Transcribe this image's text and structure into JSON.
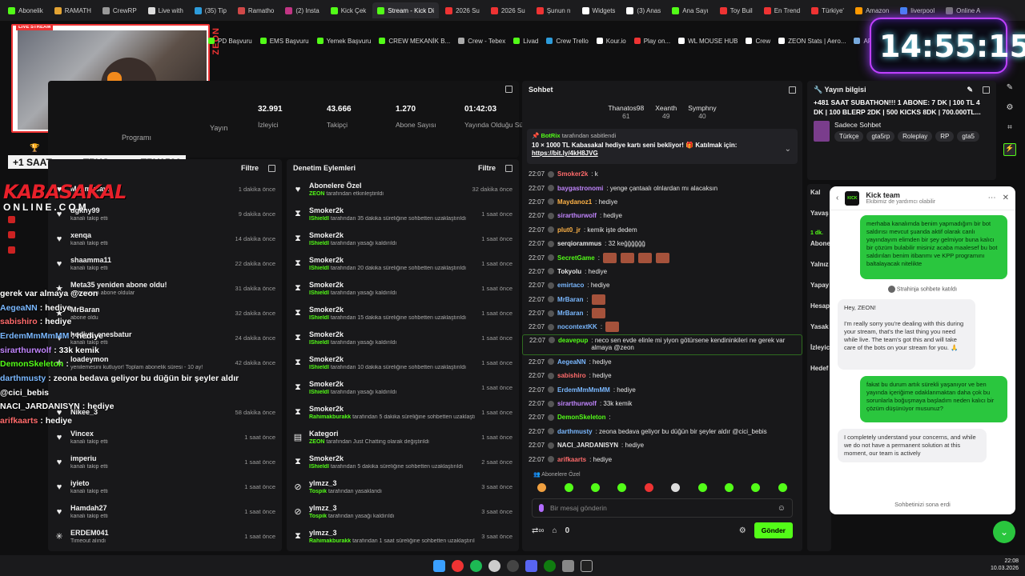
{
  "tabs": [
    {
      "label": "Abonelik",
      "color": "#53fc18"
    },
    {
      "label": "RAMATH",
      "color": "#e3a333"
    },
    {
      "label": "CrewRP",
      "color": "#999999"
    },
    {
      "label": "Live with",
      "color": "#dddddd"
    },
    {
      "label": "(35) Tip",
      "color": "#2d9cdb"
    },
    {
      "label": "Ramatho",
      "color": "#d04848"
    },
    {
      "label": "(2) Insta",
      "color": "#c13584"
    },
    {
      "label": "Kick Çek",
      "color": "#53fc18"
    },
    {
      "label": "Stream - Kick Di",
      "color": "#53fc18",
      "active": true
    },
    {
      "label": "2026 Su",
      "color": "#e33"
    },
    {
      "label": "2026 Su",
      "color": "#e33"
    },
    {
      "label": "Şunun n",
      "color": "#e33"
    },
    {
      "label": "Widgets",
      "color": "#fff"
    },
    {
      "label": "(3) Anas",
      "color": "#fff"
    },
    {
      "label": "Ana Sayı",
      "color": "#53fc18"
    },
    {
      "label": "Toy Buil",
      "color": "#e33"
    },
    {
      "label": "En Trend",
      "color": "#e33"
    },
    {
      "label": "Türkiye'",
      "color": "#e33"
    },
    {
      "label": "Amazon",
      "color": "#ff9900"
    },
    {
      "label": "liverpool",
      "color": "#4285f4"
    },
    {
      "label": "Online A",
      "color": "#777"
    }
  ],
  "bookmarks": [
    {
      "label": "PD Başvuru",
      "color": "#53fc18"
    },
    {
      "label": "EMS Başvuru",
      "color": "#53fc18"
    },
    {
      "label": "Yemek Başvuru",
      "color": "#53fc18"
    },
    {
      "label": "CREW MEKANİK B...",
      "color": "#53fc18"
    },
    {
      "label": "Crew - Tebex",
      "color": "#aaa"
    },
    {
      "label": "Livad",
      "color": "#53fc18"
    },
    {
      "label": "Crew Trello",
      "color": "#2d9cdb"
    },
    {
      "label": "Kour.io",
      "color": "#fff"
    },
    {
      "label": "Play on...",
      "color": "#e33"
    },
    {
      "label": "WL MOUSE HUB",
      "color": "#fff"
    },
    {
      "label": "Crew",
      "color": "#fff"
    },
    {
      "label": "ZEON Stats | Aero...",
      "color": "#fff"
    },
    {
      "label": "APIq",
      "color": "#7ad"
    }
  ],
  "clock": "14:55:15",
  "webcam": {
    "brand": "ZEON"
  },
  "subathon": {
    "left": "+1 SAAT",
    "mid": "TRYO",
    "right": "TRY1500"
  },
  "kabasakal": {
    "line1": "KABASAKAL",
    "line2": "ONLINE.COM"
  },
  "stats": [
    {
      "value": "32.991",
      "label": "İzleyici"
    },
    {
      "value": "43.666",
      "label": "Takipçi"
    },
    {
      "value": "1.270",
      "label": "Abone Sayısı"
    },
    {
      "value": "01:42:03",
      "label": "Yayında Olduğu Süre"
    }
  ],
  "stats_extra": {
    "yayin": "Yayın",
    "programi": "Programı"
  },
  "activity": {
    "filter": "Filtre",
    "rows": [
      {
        "t1": "Malimusavir",
        "t2": "",
        "time": "1 dakika önce",
        "icon": "♥"
      },
      {
        "t1": "dgkny99",
        "t2": "kanalı takip etti",
        "time": "9 dakika önce",
        "icon": "♥"
      },
      {
        "t1": "xenqa",
        "t2": "kanalı takip etti",
        "time": "14 dakika önce",
        "icon": "♥"
      },
      {
        "t1": "shaamma11",
        "t2": "kanalı takip etti",
        "time": "22 dakika önce",
        "icon": "♥"
      },
      {
        "t1": "Meta35 yeniden abone oldu!",
        "t2": "ay boyunca abone oldular",
        "time": "31 dakika önce",
        "icon": "★"
      },
      {
        "t1": "MrBaran",
        "t2": "abone oldu",
        "time": "32 dakika önce",
        "icon": "★"
      },
      {
        "t1": "hediye_enesbatur",
        "t2": "kanalı takip etti",
        "time": "24 dakika önce",
        "icon": "♥"
      },
      {
        "t1": "loadeymon",
        "t2": "yenilemesini kutluyor! Toplam abonelik süresi - 10 ay!",
        "time": "42 dakika önce",
        "icon": "★"
      },
      {
        "t1": "",
        "t2": "",
        "time": "",
        "icon": ""
      },
      {
        "t1": "Nikee_3",
        "t2": "",
        "time": "58 dakika önce",
        "icon": "♥"
      },
      {
        "t1": "Vincex",
        "t2": "kanalı takip etti",
        "time": "1 saat önce",
        "icon": "♥"
      },
      {
        "t1": "imperiu",
        "t2": "kanalı takip etti",
        "time": "1 saat önce",
        "icon": "♥"
      },
      {
        "t1": "iyieto",
        "t2": "kanalı takip etti",
        "time": "1 saat önce",
        "icon": "♥"
      },
      {
        "t1": "Hamdah27",
        "t2": "kanalı takip etti",
        "time": "1 saat önce",
        "icon": "♥"
      },
      {
        "t1": "ERDEM041",
        "t2": "Timeout alındı",
        "time": "1 saat önce",
        "icon": "✳"
      }
    ]
  },
  "moderation": {
    "title": "Denetim Eylemleri",
    "filter": "Filtre",
    "rows": [
      {
        "t1": "Abonelere Özel",
        "who": "ZEON",
        "rest": " tarafından etkinleştirildi",
        "time": "32 dakika önce",
        "icon": "♥"
      },
      {
        "t1": "Smoker2k",
        "who": "IShieldI",
        "rest": " tarafından 35 dakika süreliğine sohbetten uzaklaştırıldı",
        "time": "1 saat önce",
        "icon": "⧗"
      },
      {
        "t1": "Smoker2k",
        "who": "IShieldI",
        "rest": " tarafından yasağı kaldırıldı",
        "time": "1 saat önce",
        "icon": "⧗"
      },
      {
        "t1": "Smoker2k",
        "who": "IShieldI",
        "rest": " tarafından 20 dakika süreliğine sohbetten uzaklaştırıldı",
        "time": "1 saat önce",
        "icon": "⧗"
      },
      {
        "t1": "Smoker2k",
        "who": "IShieldI",
        "rest": " tarafından yasağı kaldırıldı",
        "time": "1 saat önce",
        "icon": "⧗"
      },
      {
        "t1": "Smoker2k",
        "who": "IShieldI",
        "rest": " tarafından 15 dakika süreliğine sohbetten uzaklaştırıldı",
        "time": "1 saat önce",
        "icon": "⧗"
      },
      {
        "t1": "Smoker2k",
        "who": "IShieldI",
        "rest": " tarafından yasağı kaldırıldı",
        "time": "1 saat önce",
        "icon": "⧗"
      },
      {
        "t1": "Smoker2k",
        "who": "IShieldI",
        "rest": " tarafından 10 dakika süreliğine sohbetten uzaklaştırıldı",
        "time": "1 saat önce",
        "icon": "⧗"
      },
      {
        "t1": "Smoker2k",
        "who": "IShieldI",
        "rest": " tarafından yasağı kaldırıldı",
        "time": "1 saat önce",
        "icon": "⧗"
      },
      {
        "t1": "Smoker2k",
        "who": "Rahimakburakk",
        "rest": " tarafından 5 dakika süreliğine sohbetten uzaklaştırıldı",
        "time": "1 saat önce",
        "icon": "⧗"
      },
      {
        "t1": "Kategori",
        "who": "ZEON",
        "rest": " tarafından Just Chatting olarak değiştirildi",
        "time": "1 saat önce",
        "icon": "▤"
      },
      {
        "t1": "Smoker2k",
        "who": "IShieldI",
        "rest": " tarafından 5 dakika süreliğine sohbetten uzaklaştırıldı",
        "time": "2 saat önce",
        "icon": "⧗"
      },
      {
        "t1": "ylmzz_3",
        "who": "Tospik",
        "rest": " tarafından yasaklandı",
        "time": "3 saat önce",
        "icon": "⊘"
      },
      {
        "t1": "ylmzz_3",
        "who": "Tospik",
        "rest": " tarafından yasağı kaldırıldı",
        "time": "3 saat önce",
        "icon": "⊘"
      },
      {
        "t1": "ylmzz_3",
        "who": "Rahimakburakk",
        "rest": " tarafından 1 saat süreliğine sohbetten uzaklaştırıldı",
        "time": "3 saat önce",
        "icon": "⧗"
      }
    ]
  },
  "chat": {
    "title": "Sohbet",
    "top": [
      {
        "name": "Thanatos98",
        "n": "61"
      },
      {
        "name": "Xeanth",
        "n": "49"
      },
      {
        "name": "Symphny",
        "n": "40"
      }
    ],
    "pinned": {
      "by": "BotRix",
      "by_rest": " tarafından sabitlendi",
      "text": "10 × 1000 TL Kabasakal hediye kartı seni bekliyor! 🎁 Katılmak için:",
      "link": "https://bit.ly/4kH8JVG"
    },
    "messages": [
      {
        "ts": "22:07",
        "u": "Smoker2k",
        "c": "#ff6b6b",
        "m": ": k"
      },
      {
        "ts": "22:07",
        "u": "baygastronomi",
        "c": "#c084fc",
        "m": ": yenge çantaalı olnlardan mı alacaksın"
      },
      {
        "ts": "22:07",
        "u": "Maydanoz1",
        "c": "#ffb347",
        "m": ": hediye"
      },
      {
        "ts": "22:07",
        "u": "sirarthurwolf",
        "c": "#c084fc",
        "m": ": hediye"
      },
      {
        "ts": "22:07",
        "u": "plut0_jr",
        "c": "#ffb347",
        "m": ": kemik işte dedem"
      },
      {
        "ts": "22:07",
        "u": "serqiorammus",
        "c": "#e6e6e6",
        "m": ": 32 keğğğğğğ"
      },
      {
        "ts": "22:07",
        "u": "SecretGame",
        "c": "#53fc18",
        "m": ":",
        "emo": 4
      },
      {
        "ts": "22:07",
        "u": "Tokyolu",
        "c": "#e6e6e6",
        "m": ": hediye"
      },
      {
        "ts": "22:07",
        "u": "emirtaco",
        "c": "#7ab8ff",
        "m": ": hediye"
      },
      {
        "ts": "22:07",
        "u": "MrBaran",
        "c": "#7ab8ff",
        "m": ":",
        "emo": 1
      },
      {
        "ts": "22:07",
        "u": "MrBaran",
        "c": "#7ab8ff",
        "m": ":",
        "emo": 1
      },
      {
        "ts": "22:07",
        "u": "nocontextKK",
        "c": "#7ab8ff",
        "m": ":",
        "emo": 1
      },
      {
        "ts": "22:07",
        "u": "deavepup",
        "c": "#53fc18",
        "m": ": neco sen evde elinle mi yiyon götürsene kendininkileri ne gerek var almaya @zeon",
        "hl": true
      },
      {
        "ts": "22:07",
        "u": "AegeaNN",
        "c": "#7ab8ff",
        "m": ": hediye"
      },
      {
        "ts": "22:07",
        "u": "sabishiro",
        "c": "#ff6b6b",
        "m": ": hediye"
      },
      {
        "ts": "22:07",
        "u": "ErdemMmMmMM",
        "c": "#7ab8ff",
        "m": ": hediye"
      },
      {
        "ts": "22:07",
        "u": "sirarthurwolf",
        "c": "#c084fc",
        "m": ": 33k kemik"
      },
      {
        "ts": "22:07",
        "u": "DemonSkeleton",
        "c": "#53fc18",
        "m": ":"
      },
      {
        "ts": "22:07",
        "u": "darthmusty",
        "c": "#7ab8ff",
        "m": ": zeona bedava geliyor bu düğün bir şeyler aldır @cici_bebis"
      },
      {
        "ts": "22:07",
        "u": "NACI_JARDANISYN",
        "c": "#e6e6e6",
        "m": ": hediye"
      },
      {
        "ts": "22:07",
        "u": "arifkaarts",
        "c": "#ff6b6b",
        "m": ": hediye"
      }
    ],
    "mode": "Abonelere Özel",
    "placeholder": "Bir mesaj gönderin",
    "send": "Gönder",
    "count": "0"
  },
  "overlay_chat": [
    {
      "u": "gerek var almaya @zeon",
      "m": "",
      "c": "#ffffff"
    },
    {
      "u": "AegeaNN",
      "m": ": hediye",
      "c": "#7ab8ff"
    },
    {
      "u": "sabishiro",
      "m": ": hediye",
      "c": "#ff6b6b"
    },
    {
      "u": "ErdemMmMmMM",
      "m": ": hediye",
      "c": "#7ab8ff"
    },
    {
      "u": "sirarthurwolf",
      "m": ": 33k kemik",
      "c": "#c084fc"
    },
    {
      "u": "DemonSkeleton",
      "m": ":",
      "c": "#53fc18"
    },
    {
      "u": "darthmusty",
      "m": ": zeona bedava geliyor bu düğün bir şeyler aldır",
      "c": "#7ab8ff"
    },
    {
      "u": "@cici_bebis",
      "m": "",
      "c": "#ffffff"
    },
    {
      "u": "NACI_JARDANISYN",
      "m": ": hediye",
      "c": "#ffffff"
    },
    {
      "u": "arifkaarts",
      "m": ": hediye",
      "c": "#ff6b6b"
    }
  ],
  "info": {
    "title": "Yayın bilgisi",
    "text": "+481 SAAT SUBATHON!!! 1 ABONE: 7 DK | 100 TL 4 DK | 100 BLERP 2DK | 500 KICKS 8DK | 700.000TL...",
    "category": "Sadece Sohbet",
    "tags": [
      "Türkçe",
      "gta5rp",
      "Roleplay",
      "RP",
      "gta5"
    ]
  },
  "side_labels": [
    "Kal",
    "Yavaş",
    "1 dk.",
    "Abone",
    "Yalnız",
    "Yapay",
    "Hesap",
    "Yasak",
    "İzleyic",
    "Hedef"
  ],
  "kick_team": {
    "name": "Kick team",
    "sub": "Ekibimiz de yardımcı olabilir",
    "msg1": "merhaba kanalımda benim yapmadığım bir bot saldırısı mevcut şuanda aktif olarak canlı yayındayım elimden bir şey gelmiyor buna kalıcı bir çözüm bulabilir misiniz acaba maalesef bu bot saldırıları benim itibarımı ve KPP programını baltalayacak nitelikte",
    "joined": "Strahinja sohbete katıldı",
    "msg2": "Hey, ZEON!\n\nI'm really sorry you're dealing with this during your stream, that's the last thing you need while live. The team's got this and will take care of the bots on your stream for you. 🙏",
    "msg3": "fakat bu durum artık sürekli yaşanıyor ve ben yayında içeriğime odaklanmaktan daha çok bu sorunlarla boğuşmaya başladım neden kalıcı bir çözüm düşünüyor musunuz?",
    "msg4": "I completely understand your concerns, and while we do not have a permanent solution at this moment, our team is actively",
    "end": "Sohbetinizi sona erdi"
  },
  "taskbar": {
    "time": "22:08",
    "date": "10.03.2026"
  }
}
